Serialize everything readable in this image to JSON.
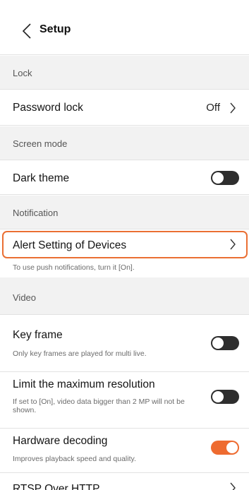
{
  "header": {
    "title": "Setup"
  },
  "sections": {
    "lock": "Lock",
    "screen_mode": "Screen mode",
    "notification": "Notification",
    "video": "Video"
  },
  "rows": {
    "password_lock": {
      "label": "Password lock",
      "value": "Off"
    },
    "dark_theme": {
      "label": "Dark theme",
      "state": "off"
    },
    "alert_setting": {
      "label": "Alert Setting of Devices",
      "note": "To use push notifications, turn it [On]."
    },
    "key_frame": {
      "label": "Key frame",
      "sub": "Only key frames are played for multi live.",
      "state": "off"
    },
    "limit_resolution": {
      "label": "Limit the maximum resolution",
      "sub": "If set to [On], video data bigger than 2 MP will not be shown.",
      "state": "off"
    },
    "hardware_decoding": {
      "label": "Hardware decoding",
      "sub": "Improves playback speed and quality.",
      "state": "on"
    },
    "rtsp": {
      "label": "RTSP Over HTTP"
    }
  },
  "colors": {
    "accent": "#ee6b30",
    "highlight_border": "#ea6f33",
    "section_bg": "#f2f2f2",
    "toggle_off": "#2e2e2e"
  }
}
